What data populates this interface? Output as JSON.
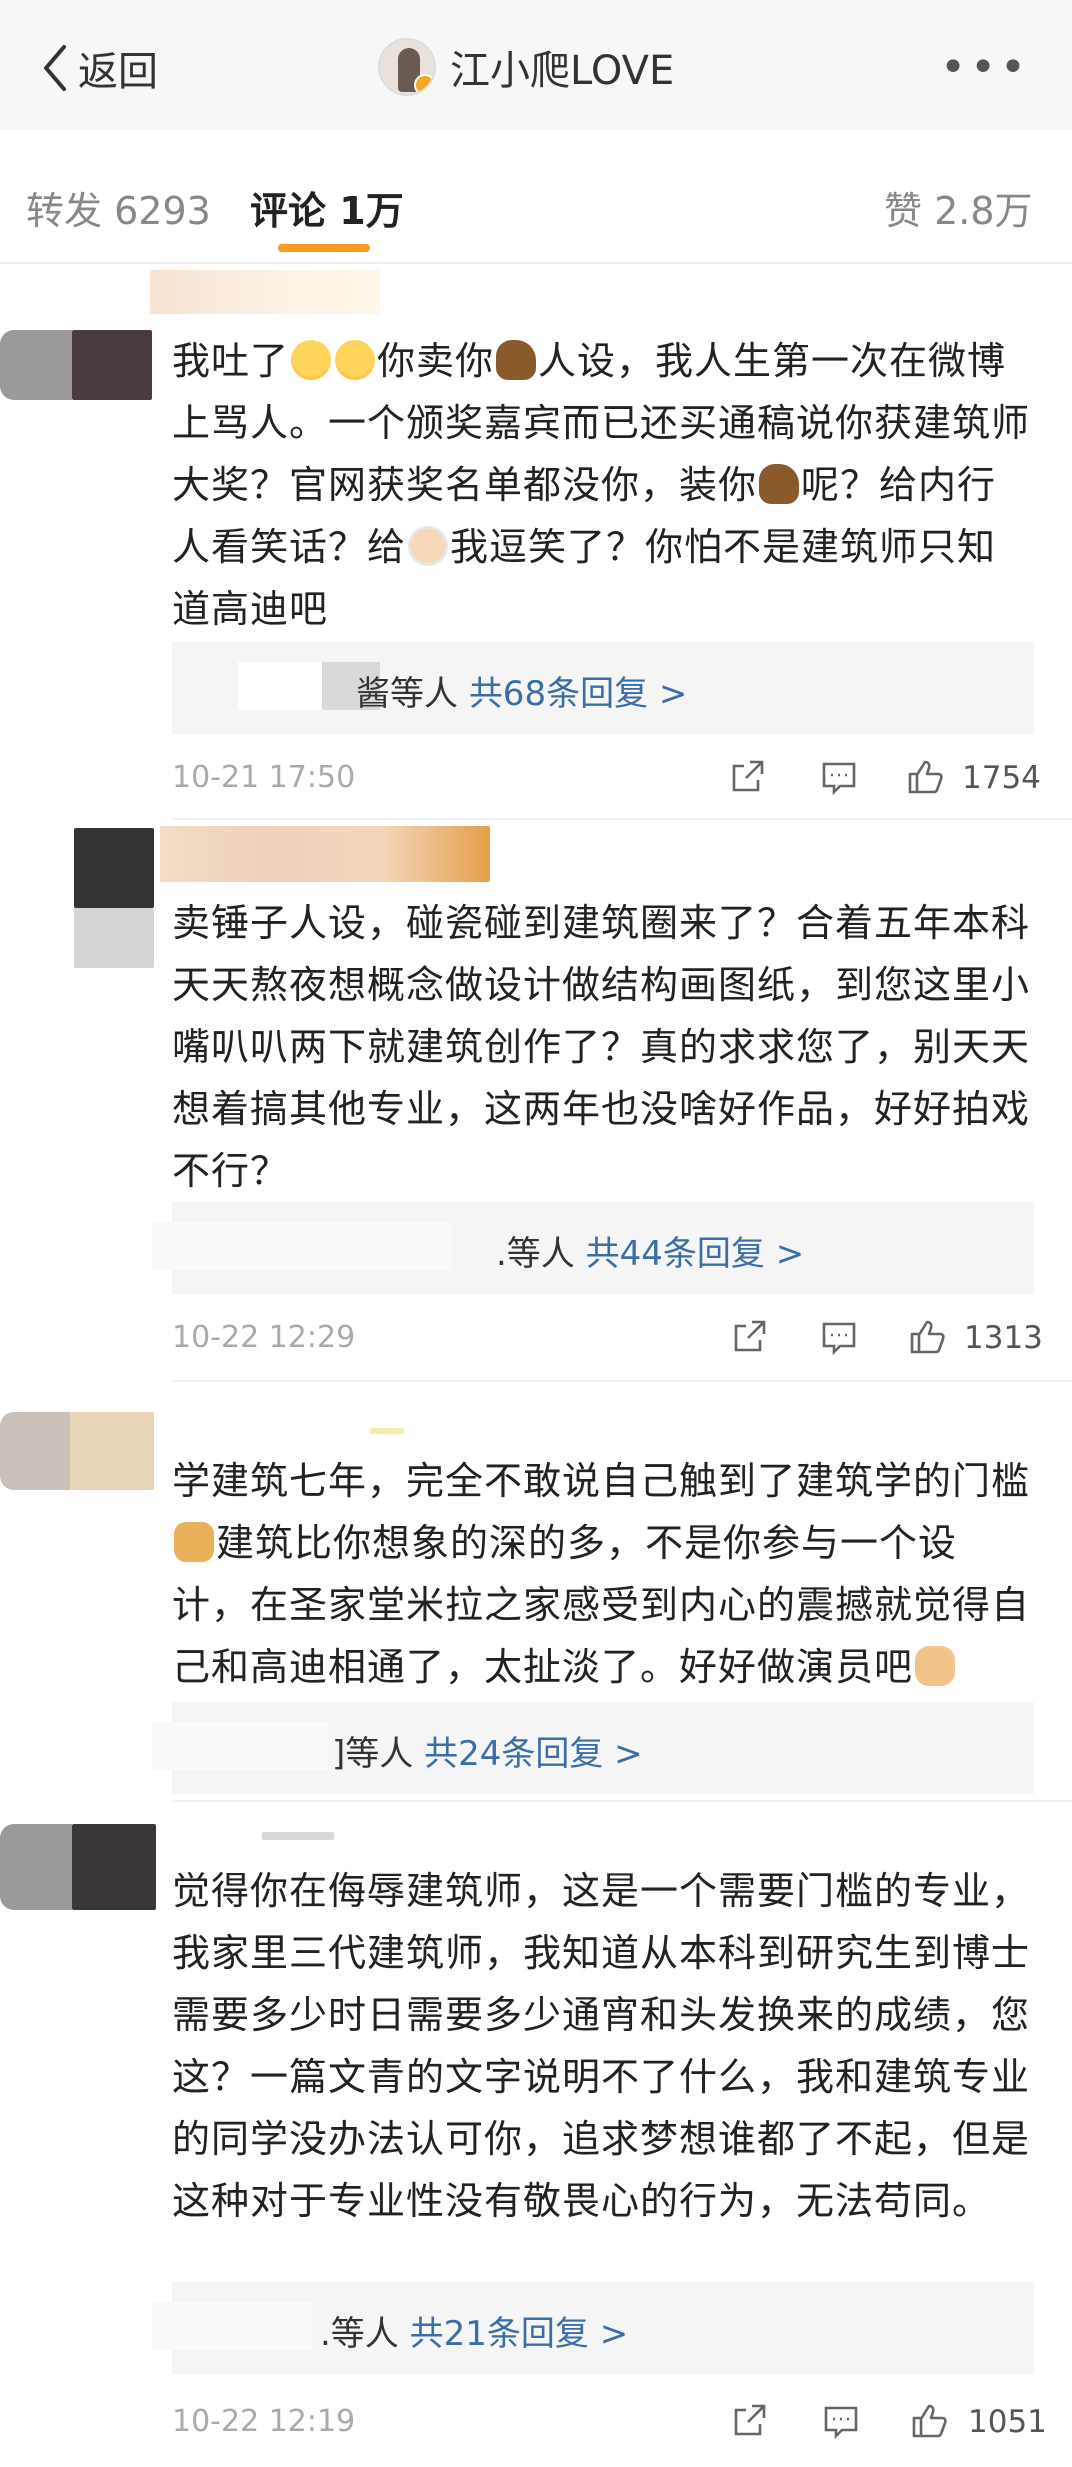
{
  "nav": {
    "back_label": "返回",
    "title": "江小爬LOVE",
    "more_label": "•••"
  },
  "tabs": [
    {
      "label": "转发",
      "count": "6293"
    },
    {
      "label": "评论",
      "count": "1万"
    },
    {
      "label": "赞",
      "count": "2.8万"
    }
  ],
  "comments": [
    {
      "text_parts": [
        "我吐了",
        "你卖你",
        "人设，我人生第一次在微博上骂人。一个颁奖嘉宾而已还买通稿说你获建筑师大奖？官网获奖名单都没你，装你",
        "呢？给内行人看笑话？给",
        "我逗笑了？你怕不是建筑师只知道高迪吧"
      ],
      "reply_prefix": "酱等人",
      "reply_link": "共68条回复 >",
      "date": "10-21 17:50",
      "likes": "1754"
    },
    {
      "text": "卖锤子人设，碰瓷碰到建筑圈来了？合着五年本科天天熬夜想概念做设计做结构画图纸，到您这里小嘴叭叭两下就建筑创作了？真的求求您了，别天天想着搞其他专业，这两年也没啥好作品，好好拍戏不行？",
      "reply_prefix": ".等人",
      "reply_link": "共44条回复 >",
      "date": "10-22 12:29",
      "likes": "1313"
    },
    {
      "text_parts": [
        "学建筑七年，完全不敢说自己触到了建筑学的门槛",
        "建筑比你想象的深的多，不是你参与一个设计，在圣家堂米拉之家感受到内心的震撼就觉得自己和高迪相通了，太扯淡了。好好做演员吧"
      ],
      "reply_prefix": "]等人",
      "reply_link": "共24条回复 >"
    },
    {
      "text": "觉得你在侮辱建筑师，这是一个需要门槛的专业，我家里三代建筑师，我知道从本科到研究生到博士需要多少时日需要多少通宵和头发换来的成绩，您这？一篇文青的文字说明不了什么，我和建筑专业的同学没办法认可你，追求梦想谁都了不起，但是这种对于专业性没有敬畏心的行为，无法苟同。",
      "reply_prefix": ".等人",
      "reply_link": "共21条回复 >",
      "date": "10-22 12:19",
      "likes": "1051"
    }
  ],
  "colors": {
    "accent_orange": "#f59a23",
    "link_blue": "#3a6ea5",
    "meta_gray": "#aaaaaa"
  },
  "icons": [
    "chevron-left-icon",
    "more-icon",
    "share-icon",
    "comment-icon",
    "like-icon"
  ]
}
